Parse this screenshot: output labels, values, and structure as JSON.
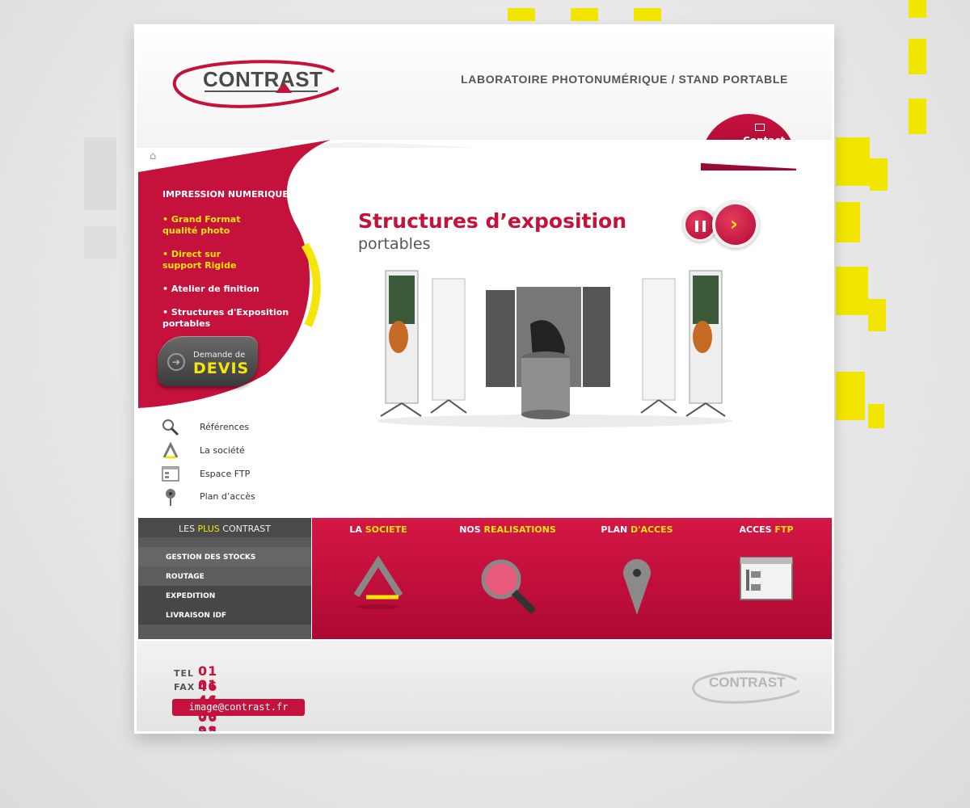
{
  "brand": {
    "logo_text": "CONTRAST",
    "tagline": "LABORATOIRE PHOTONUMÉRIQUE / STAND PORTABLE"
  },
  "contact_tab": {
    "label": "Contact",
    "icon": "envelope-icon"
  },
  "nav": {
    "heading": "IMPRESSION NUMERIQUE",
    "items": [
      {
        "line1": "• Grand Format",
        "line2": "qualité photo"
      },
      {
        "line1": "• Direct sur",
        "line2": "support Rigide"
      },
      {
        "line1": "• Atelier de finition",
        "line2": ""
      },
      {
        "line1": "• Structures d'Exposition",
        "line2": "portables"
      }
    ]
  },
  "devis": {
    "top": "Demande de",
    "main": "DEVIS"
  },
  "hero": {
    "title": "Structures d’exposition",
    "subtitle": "portables"
  },
  "links": [
    {
      "label": "Références",
      "icon": "magnifier-icon"
    },
    {
      "label": "La société",
      "icon": "logo-a-icon"
    },
    {
      "label": "Espace FTP",
      "icon": "ftp-window-icon"
    },
    {
      "label": "Plan d’accès",
      "icon": "map-pin-icon"
    }
  ],
  "plus": {
    "title_pre": "LES ",
    "title_hl": "PLUS",
    "title_post": " CONTRAST",
    "items": [
      "GESTION DES STOCKS",
      "ROUTAGE",
      "EXPEDITION",
      "LIVRAISON IDF"
    ]
  },
  "features": [
    {
      "pre": "LA ",
      "hl": "SOCIETE",
      "icon": "logo-a-icon"
    },
    {
      "pre": "NOS ",
      "hl": "REALISATIONS",
      "icon": "magnifier-icon"
    },
    {
      "pre": "PLAN ",
      "hl": "D'ACCES",
      "icon": "map-pin-icon"
    },
    {
      "pre": "ACCES ",
      "hl": "FTP",
      "icon": "ftp-window-icon"
    }
  ],
  "footer": {
    "tel_label": "TEL",
    "tel": "01 46 44 06 32",
    "fax_label": "FAX",
    "fax": "01 46 38 98 06",
    "email": "image@contrast.fr",
    "logo_text": "CONTRAST"
  },
  "colors": {
    "brand_red": "#c4123c",
    "accent_yellow": "#f5e60a",
    "dark_grey": "#4a4a4a"
  }
}
